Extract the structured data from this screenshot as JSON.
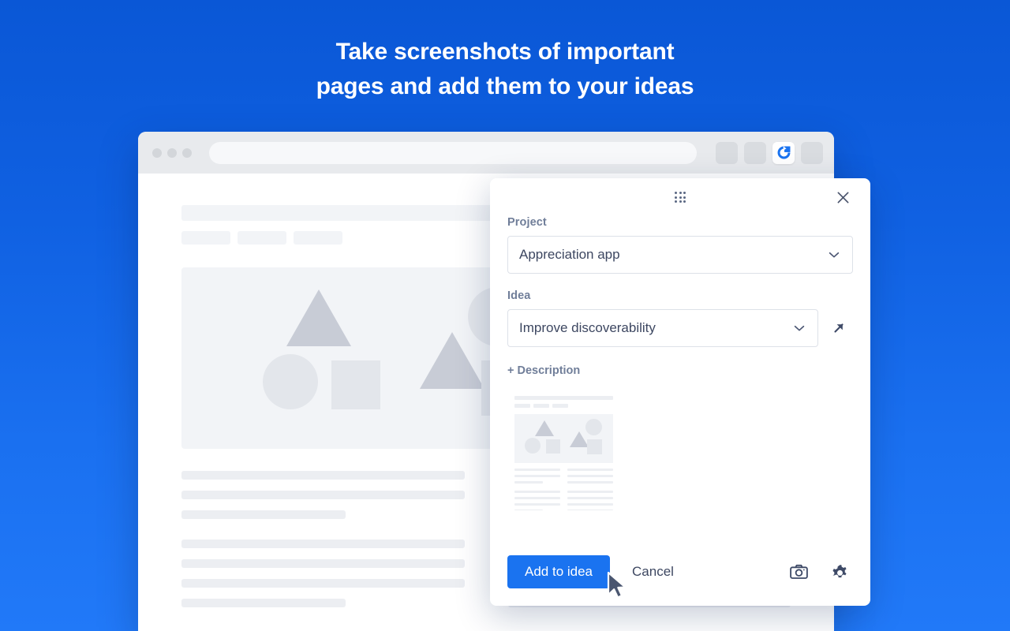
{
  "headline": {
    "line1": "Take screenshots of important",
    "line2": "pages and add them to your ideas"
  },
  "colors": {
    "background_top": "#0a57d6",
    "background_bottom": "#2179f8",
    "accent": "#1a73f0",
    "label_text": "#707e99",
    "value_text": "#3d4761"
  },
  "browser": {
    "traffic_lights": [
      "close-dot",
      "minimize-dot",
      "maximize-dot"
    ],
    "address_bar_value": "",
    "address_bar_placeholder": "",
    "toolbar_buttons": [
      {
        "name": "toolbar-button-1",
        "active": false
      },
      {
        "name": "toolbar-button-2",
        "active": false
      },
      {
        "name": "extension-icon",
        "active": true
      },
      {
        "name": "toolbar-button-4",
        "active": false
      }
    ]
  },
  "dialog": {
    "drag_handle": "drag-handle-icon",
    "close_icon": "close-icon",
    "project": {
      "label": "Project",
      "value": "Appreciation app",
      "chevron": "chevron-down-icon"
    },
    "idea": {
      "label": "Idea",
      "value": "Improve discoverability",
      "chevron": "chevron-down-icon",
      "open_icon": "external-link-arrow-icon"
    },
    "description_toggle": "+ Description",
    "screenshot_preview_alt": "page-screenshot-thumbnail",
    "actions": {
      "primary": "Add to idea",
      "secondary": "Cancel",
      "camera_icon": "camera-icon",
      "settings_icon": "gear-icon"
    }
  }
}
